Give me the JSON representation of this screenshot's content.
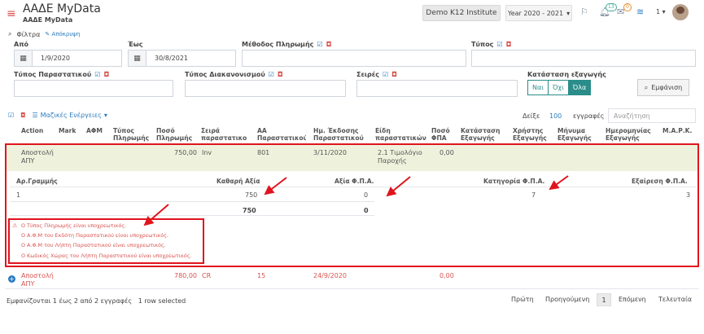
{
  "app": {
    "title": "ΑΑΔΕ MyData",
    "subtitle": "ΑΑΔΕ MyData",
    "company": "Demo K12 Institute",
    "year": "Year 2020 - 2021",
    "year_caret": "▾",
    "notifications_count": "13",
    "messages_count": "0",
    "user_num": "1 ▾"
  },
  "filters": {
    "toggle_label": "Φίλτρα",
    "hide_label": "Απόκρυψη",
    "from_label": "Από",
    "from_value": "1/9/2020",
    "to_label": "Έως",
    "to_value": "30/8/2021",
    "payment_method_label": "Μέθοδος Πληρωμής",
    "type_label": "Τύπος",
    "doc_type_label": "Τύπος Παραστατικού",
    "settlement_type_label": "Τύπος Διακανονισμού",
    "series_label": "Σειρές",
    "export_status_label": "Κατάσταση εξαγωγής",
    "status_options": [
      "Ναι",
      "Όχι",
      "Όλα"
    ],
    "status_selected": "Όλα",
    "show_button": "Εμφάνιση"
  },
  "toolbar": {
    "bulk_actions": "Μαζικές Ενέργειες",
    "bulk_caret": "▾",
    "show_label": "Δείξε",
    "page_size": "100",
    "records_label": "εγγραφές",
    "search_placeholder": "Αναζήτηση"
  },
  "columns": [
    "Action",
    "Mark",
    "ΑΦΜ",
    "Τύπος Πληρωμής",
    "Ποσό Πληρωμής",
    "Σειρά παραστατικού",
    "ΑΑ Παραστατικού",
    "Ημ. Έκδοσης Παραστατικού",
    "Είδη παραστατικών",
    "Ποσό ΦΠΑ",
    "Κατάσταση Εξαγωγής",
    "Χρήστης Εξαγωγής",
    "Μήνυμα Εξαγωγής",
    "Ημερομηνίας Εξαγωγής",
    "Μ.Α.Ρ.Κ."
  ],
  "rows": [
    {
      "action": "Αποστολή ΑΠΥ",
      "amount": "750,00",
      "series": "Inv",
      "number": "801",
      "date": "3/11/2020",
      "doc_type": "2.1 Τιμολόγιο Παροχής",
      "vat": "0,00"
    },
    {
      "action": "Αποστολή ΑΠΥ",
      "amount": "780,00",
      "series": "CR",
      "number": "15",
      "date": "24/9/2020",
      "vat": "0,00"
    }
  ],
  "detail": {
    "headers": [
      "Αρ.Γραμμής",
      "Καθαρή Αξία",
      "Αξία Φ.Π.Α.",
      "Κατηγορία Φ.Π.Α.",
      "Εξαίρεση Φ.Π.Α."
    ],
    "values": [
      "1",
      "750",
      "0",
      "7",
      "3"
    ],
    "totals": [
      "750",
      "0"
    ]
  },
  "errors": [
    "Ο Τύπος Πληρωμής είναι υποχρεωτικός.",
    "Ο Α.Φ.Μ του Εκδότη Παραστατικού είναι υποχρεωτικός.",
    "Ο Α.Φ.Μ του Λήπτη Παραστατικού είναι υποχρεωτικός.",
    "Ο Κωδικός Χώρας του Λήπτη Παραστατικού είναι υποχρεωτικός."
  ],
  "footer": {
    "info": "Εμφανίζονται 1 έως 2 από 2 εγγραφές",
    "selected": "1 row selected",
    "first": "Πρώτη",
    "previous": "Προηγούμενη",
    "current": "1",
    "next": "Επόμενη",
    "last": "Τελευταία"
  },
  "colors": {
    "accent": "#2b7bbf",
    "teal": "#2a8d8a",
    "error": "#e0141d",
    "row_highlight": "#eef2dc"
  }
}
